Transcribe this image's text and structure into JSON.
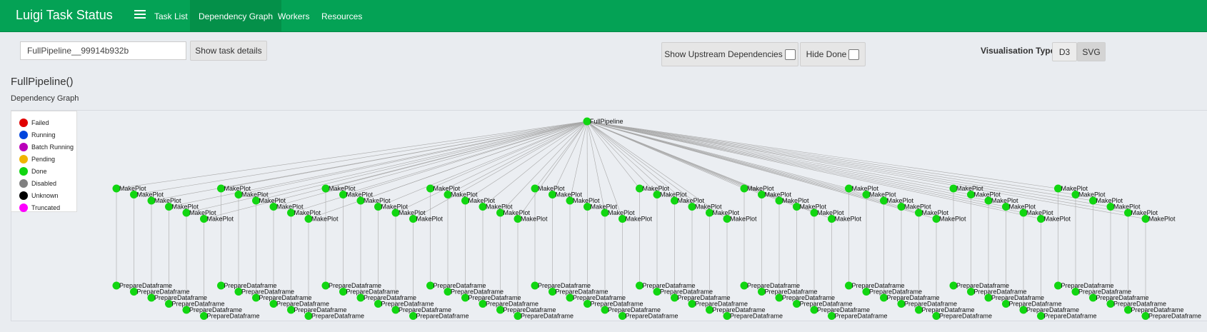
{
  "app": {
    "title": "Luigi Task Status"
  },
  "nav": {
    "items": [
      {
        "label": "Task List"
      },
      {
        "label": "Dependency Graph"
      },
      {
        "label": "Workers"
      },
      {
        "label": "Resources"
      }
    ],
    "active": "Dependency Graph"
  },
  "toolbar": {
    "task_input_value": "FullPipeline__99914b932b",
    "show_details_label": "Show task details",
    "show_upstream_label": "Show Upstream Dependencies",
    "hide_done_label": "Hide Done",
    "vis_type_label": "Visualisation Type",
    "vis_d3_label": "D3",
    "vis_svg_label": "SVG",
    "vis_selected": "SVG"
  },
  "page": {
    "title": "FullPipeline()",
    "section": "Dependency Graph"
  },
  "legend": [
    {
      "label": "Failed",
      "color": "#e00000"
    },
    {
      "label": "Running",
      "color": "#0044dd"
    },
    {
      "label": "Batch Running",
      "color": "#b900b9"
    },
    {
      "label": "Pending",
      "color": "#f0b400"
    },
    {
      "label": "Done",
      "color": "#11d611"
    },
    {
      "label": "Disabled",
      "color": "#808080"
    },
    {
      "label": "Unknown",
      "color": "#000000"
    },
    {
      "label": "Truncated",
      "color": "#ff00ff"
    }
  ],
  "graph": {
    "node_color": "#11d611",
    "root": {
      "label": "FullPipeline"
    },
    "groups": 10,
    "per_group": 6,
    "mid_label": "MakePlot",
    "leaf_label": "PrepareDataframe"
  }
}
